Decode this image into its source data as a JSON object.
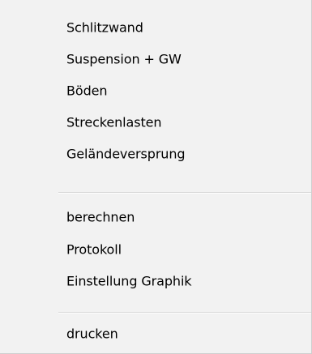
{
  "menu": {
    "group1": [
      {
        "label": "Schlitzwand"
      },
      {
        "label": "Suspension + GW"
      },
      {
        "label": "Böden"
      },
      {
        "label": "Streckenlasten"
      },
      {
        "label": "Geländeversprung"
      }
    ],
    "group2": [
      {
        "label": "berechnen"
      },
      {
        "label": "Protokoll"
      },
      {
        "label": "Einstellung Graphik"
      }
    ],
    "group3": [
      {
        "label": "drucken"
      }
    ]
  }
}
